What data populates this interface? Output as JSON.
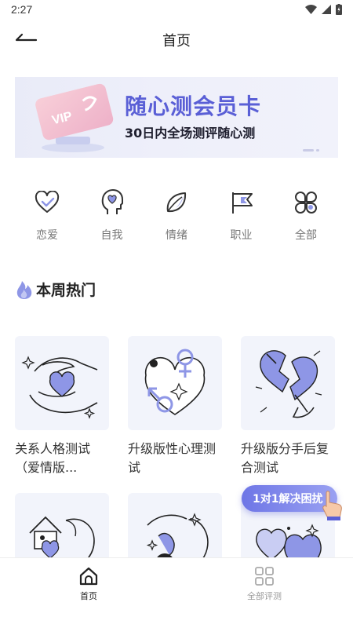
{
  "status_bar": {
    "time": "2:27"
  },
  "header": {
    "title": "首页"
  },
  "banner": {
    "title": "随心测会员卡",
    "subtitle": "30日内全场测评随心测",
    "badge": "VIP"
  },
  "categories": [
    {
      "label": "恋爱",
      "icon": "heart-check-icon"
    },
    {
      "label": "自我",
      "icon": "head-heart-icon"
    },
    {
      "label": "情绪",
      "icon": "leaf-icon"
    },
    {
      "label": "职业",
      "icon": "flag-icon"
    },
    {
      "label": "全部",
      "icon": "clover-icon"
    }
  ],
  "section": {
    "title": "本周热门"
  },
  "cards": [
    {
      "title": "关系人格测试（爱情版..."
    },
    {
      "title": "升级版性心理测试"
    },
    {
      "title": "升级版分手后复合测试"
    },
    {
      "title": ""
    },
    {
      "title": ""
    },
    {
      "title": ""
    }
  ],
  "float_button": {
    "label": "1对1解决困扰"
  },
  "tabs": [
    {
      "label": "首页",
      "active": true
    },
    {
      "label": "全部评测",
      "active": false
    }
  ],
  "colors": {
    "accent": "#5a5fd6",
    "illustration_fill": "#8e96e6",
    "icon_stroke": "#333333"
  }
}
